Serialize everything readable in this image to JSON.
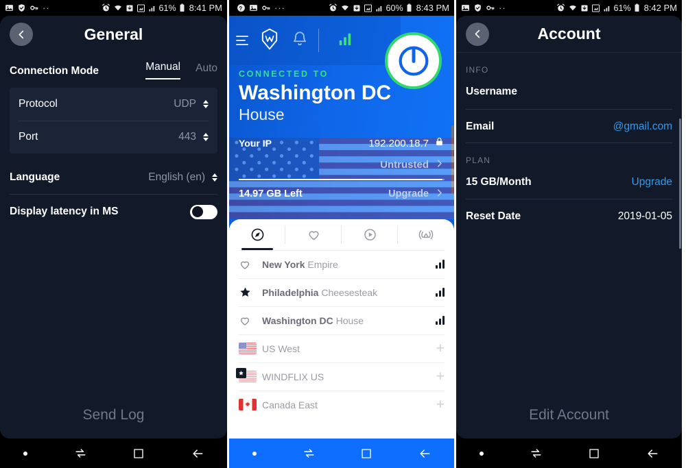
{
  "panels": {
    "general": {
      "statusbar": {
        "left_icons": [
          "image-icon",
          "shield-check-icon",
          "key-icon",
          "more-dots-icon"
        ],
        "right_icons": [
          "alarm-icon",
          "wifi-icon",
          "download-icon",
          "signal-icon",
          "signal2-icon",
          "battery-icon"
        ],
        "battery": "61%",
        "time": "8:41 PM"
      },
      "header": {
        "title": "General",
        "back": "back-icon"
      },
      "connection_mode": {
        "label": "Connection Mode",
        "tabs": [
          {
            "label": "Manual",
            "active": true
          },
          {
            "label": "Auto",
            "active": false
          }
        ]
      },
      "settings": [
        {
          "label": "Protocol",
          "value": "UDP",
          "control": "stepper"
        },
        {
          "label": "Port",
          "value": "443",
          "control": "stepper"
        }
      ],
      "language": {
        "label": "Language",
        "value": "English (en)",
        "control": "stepper"
      },
      "latency": {
        "label": "Display latency in MS",
        "toggle_on": false
      },
      "bottom_action": "Send Log"
    },
    "main": {
      "statusbar": {
        "left_icons": [
          "vpn-key-icon",
          "image-icon",
          "key-icon",
          "more-dots-icon"
        ],
        "battery": "60%",
        "time": "8:43 PM"
      },
      "topbar": {
        "menu": "hamburger-icon",
        "logo": "windscribe-logo-icon",
        "notifications": "bell-icon",
        "signal": "signal-bars-icon",
        "power": "power-button-icon"
      },
      "connected_to_label": "CONNECTED TO",
      "location": "Washington DC",
      "location_sub": "House",
      "ip": {
        "label": "Your IP",
        "value": "192.200.18.7",
        "icon": "lock-icon"
      },
      "network": {
        "value": "Untrusted"
      },
      "quota": {
        "label": "14.97 GB Left",
        "action": "Upgrade",
        "fill_percent": 99
      },
      "tabs": [
        {
          "name": "all-locations-tab",
          "icon": "compass-icon",
          "active": true
        },
        {
          "name": "favourites-tab",
          "icon": "heart-icon",
          "active": false
        },
        {
          "name": "streaming-tab",
          "icon": "play-circle-icon",
          "active": false
        },
        {
          "name": "static-ip-tab",
          "icon": "static-ip-icon",
          "active": false
        }
      ],
      "servers": [
        {
          "fav": "heart-icon",
          "city": "New York",
          "nick": "Empire",
          "signal": 3,
          "type": "city"
        },
        {
          "fav": "star-icon",
          "city": "Philadelphia",
          "nick": "Cheesesteak",
          "signal": 3,
          "type": "city"
        },
        {
          "fav": "heart-icon",
          "city": "Washington DC",
          "nick": "House",
          "signal": 3,
          "type": "city"
        },
        {
          "flag": "us",
          "name": "US West",
          "expand": "+",
          "type": "country"
        },
        {
          "flag": "us-star",
          "name": "WINDFLIX US",
          "expand": "+",
          "type": "country"
        },
        {
          "flag": "ca",
          "name": "Canada East",
          "expand": "+",
          "type": "country"
        }
      ]
    },
    "account": {
      "statusbar": {
        "left_icons": [
          "image-icon",
          "shield-check-icon",
          "key-icon",
          "more-dots-icon"
        ],
        "battery": "61%",
        "time": "8:42 PM"
      },
      "header": {
        "title": "Account",
        "back": "back-icon"
      },
      "sections": [
        {
          "label": "INFO",
          "rows": [
            {
              "label": "Username",
              "value": ""
            },
            {
              "label": "Email",
              "value": "@gmail.com",
              "link": true
            }
          ]
        },
        {
          "label": "PLAN",
          "rows": [
            {
              "label": "15 GB/Month",
              "value": "Upgrade",
              "link": true
            },
            {
              "label": "Reset Date",
              "value": "2019-01-05"
            }
          ]
        }
      ],
      "bottom_action": "Edit Account"
    }
  },
  "navbar": {
    "items": [
      "dot-icon",
      "switch-icon",
      "recents-square-icon",
      "back-arrow-icon"
    ]
  },
  "colors": {
    "dark_bg": "#121a29",
    "group_bg": "#1b2336",
    "blue": "#0b5fe0",
    "green": "#2fd96b",
    "link": "#2f9bf0",
    "nav_blue": "#0d6eff"
  }
}
